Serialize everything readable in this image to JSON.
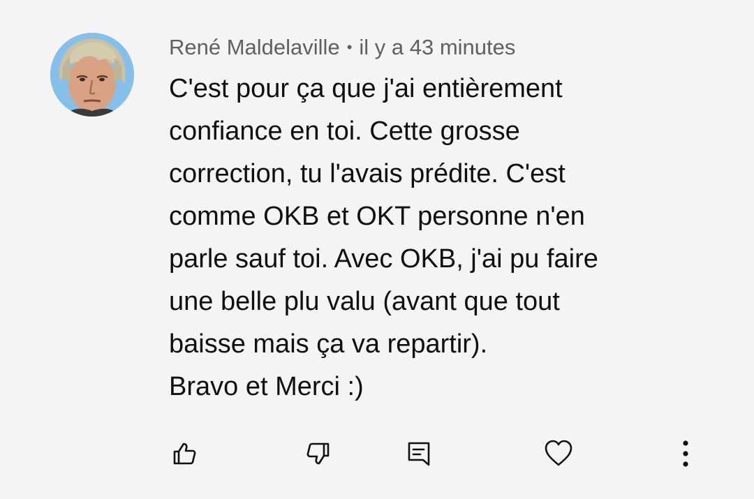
{
  "comment": {
    "author": "René Maldelaville",
    "separator": "•",
    "timestamp": "il y a 43 minutes",
    "lines": [
      "C'est pour ça que j'ai entièrement",
      "confiance en toi. Cette grosse",
      "correction, tu l'avais prédite. C'est",
      "comme OKB et OKT personne n'en",
      "parle sauf toi. Avec OKB, j'ai pu faire",
      "une belle plu valu (avant que tout",
      "baisse mais ça va repartir).",
      "Bravo et Merci :)"
    ]
  },
  "actions": {
    "like_icon": "thumbs-up-icon",
    "dislike_icon": "thumbs-down-icon",
    "reply_icon": "comment-reply-icon",
    "heart_icon": "heart-icon",
    "more_icon": "more-vertical-icon"
  },
  "colors": {
    "background": "#f4f4f4",
    "text": "#0f0f0f",
    "meta": "#606060"
  }
}
